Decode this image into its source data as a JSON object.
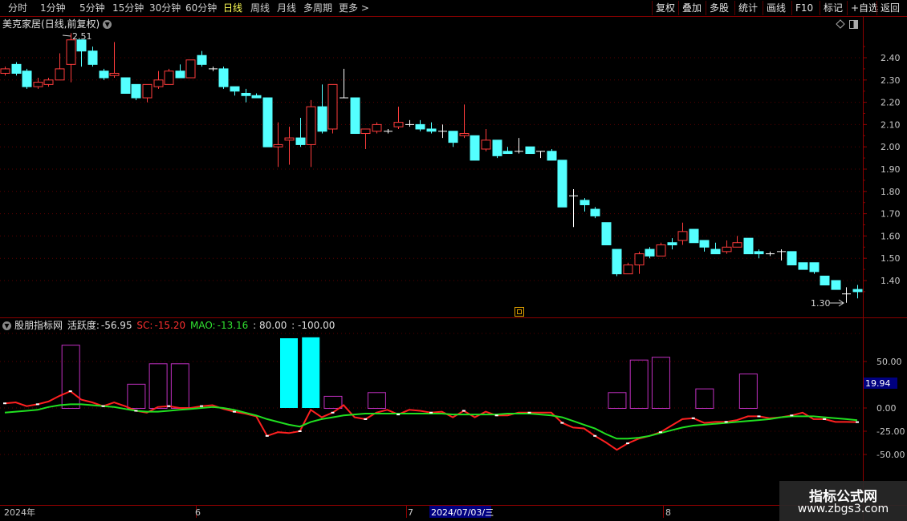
{
  "toolbar": {
    "periods": [
      "分时",
      "1分钟",
      "5分钟",
      "15分钟",
      "30分钟",
      "60分钟",
      "日线",
      "周线",
      "月线",
      "多周期",
      "更多"
    ],
    "active_period": "日线",
    "more_arrow": ">",
    "right_buttons": [
      "复权",
      "叠加",
      "多股",
      "统计",
      "画线",
      "F10",
      "标记",
      "+自选",
      "返回"
    ]
  },
  "main_chart": {
    "stock_name": "美克家居",
    "mode": "(日线,前复权)",
    "high_label": "2.51",
    "low_label": "1.30",
    "price_ticks": [
      "2.40",
      "2.30",
      "2.20",
      "2.10",
      "2.00",
      "1.90",
      "1.80",
      "1.70",
      "1.60",
      "1.50",
      "1.40"
    ]
  },
  "indicator": {
    "name": "股朋指标网",
    "active_label": "活跃度:",
    "active_value": "-56.95",
    "sc_label": "SC:",
    "sc_value": "-15.20",
    "mao_label": "MAO:",
    "mao_value": "-13.16",
    "level1": ": 80.00",
    "level2": ": -100.00",
    "ticks": [
      "50.00",
      "0.00",
      "-25.00",
      "-50.00"
    ],
    "current_badge": "19.94"
  },
  "time_axis": {
    "labels": [
      "2024年",
      "6",
      "7",
      "8"
    ],
    "highlight_date": "2024/07/03/三"
  },
  "watermark": {
    "title": "指标公式网",
    "url": "www.zbgs3.com"
  },
  "colors": {
    "up": "#ff3c3c",
    "down": "#54ffff",
    "sc_line": "#ff2020",
    "mao_line": "#20e020",
    "bars_outline": "#c030c0",
    "bars_fill": "#00ffff",
    "axis": "#8b0000"
  },
  "chart_data": [
    {
      "type": "candlestick",
      "title": "美克家居(日线,前复权)",
      "ylim": [
        1.28,
        2.53
      ],
      "series": [
        {
          "name": "K",
          "ohlc": [
            [
              2.33,
              2.36,
              2.32,
              2.35
            ],
            [
              2.37,
              2.38,
              2.32,
              2.33
            ],
            [
              2.34,
              2.35,
              2.26,
              2.27
            ],
            [
              2.27,
              2.31,
              2.26,
              2.29
            ],
            [
              2.28,
              2.31,
              2.27,
              2.3
            ],
            [
              2.3,
              2.42,
              2.3,
              2.35
            ],
            [
              2.37,
              2.51,
              2.29,
              2.48
            ],
            [
              2.48,
              2.48,
              2.36,
              2.43
            ],
            [
              2.43,
              2.45,
              2.36,
              2.37
            ],
            [
              2.34,
              2.35,
              2.3,
              2.31
            ],
            [
              2.32,
              2.47,
              2.31,
              2.33
            ],
            [
              2.31,
              2.31,
              2.26,
              2.24
            ],
            [
              2.28,
              2.28,
              2.21,
              2.22
            ],
            [
              2.22,
              2.28,
              2.2,
              2.28
            ],
            [
              2.27,
              2.34,
              2.26,
              2.3
            ],
            [
              2.28,
              2.35,
              2.28,
              2.34
            ],
            [
              2.34,
              2.37,
              2.31,
              2.31
            ],
            [
              2.31,
              2.39,
              2.31,
              2.39
            ],
            [
              2.41,
              2.43,
              2.36,
              2.37
            ],
            [
              2.35,
              2.36,
              2.34,
              2.35
            ],
            [
              2.35,
              2.36,
              2.26,
              2.27
            ],
            [
              2.27,
              2.27,
              2.23,
              2.25
            ],
            [
              2.24,
              2.26,
              2.2,
              2.23
            ],
            [
              2.23,
              2.24,
              2.22,
              2.22
            ],
            [
              2.22,
              2.22,
              2.0,
              2.0
            ],
            [
              2.0,
              2.11,
              1.91,
              2.01
            ],
            [
              2.03,
              2.09,
              1.92,
              2.04
            ],
            [
              2.04,
              2.13,
              2.0,
              2.01
            ],
            [
              2.01,
              2.21,
              1.91,
              2.18
            ],
            [
              2.18,
              2.28,
              2.06,
              2.07
            ],
            [
              2.08,
              2.28,
              2.06,
              2.28
            ],
            [
              2.22,
              2.35,
              2.22,
              2.22
            ],
            [
              2.22,
              2.22,
              2.06,
              2.06
            ],
            [
              2.06,
              2.08,
              1.99,
              2.08
            ],
            [
              2.07,
              2.11,
              2.06,
              2.1
            ],
            [
              2.07,
              2.08,
              2.06,
              2.07
            ],
            [
              2.09,
              2.18,
              2.08,
              2.11
            ],
            [
              2.1,
              2.12,
              2.09,
              2.1
            ],
            [
              2.1,
              2.12,
              2.07,
              2.08
            ],
            [
              2.08,
              2.11,
              2.06,
              2.07
            ],
            [
              2.07,
              2.1,
              2.04,
              2.07
            ],
            [
              2.07,
              2.07,
              2.0,
              2.02
            ],
            [
              2.05,
              2.19,
              2.04,
              2.06
            ],
            [
              2.05,
              2.05,
              1.94,
              1.94
            ],
            [
              1.99,
              2.08,
              1.98,
              2.03
            ],
            [
              2.03,
              2.03,
              1.95,
              1.96
            ],
            [
              1.98,
              2.0,
              1.97,
              1.97
            ],
            [
              1.98,
              2.04,
              1.97,
              1.98
            ],
            [
              2.0,
              2.0,
              1.99,
              1.97
            ],
            [
              1.98,
              1.98,
              1.95,
              1.98
            ],
            [
              1.98,
              1.99,
              1.96,
              1.94
            ],
            [
              1.94,
              1.94,
              1.73,
              1.73
            ],
            [
              1.78,
              1.81,
              1.64,
              1.78
            ],
            [
              1.76,
              1.77,
              1.71,
              1.74
            ],
            [
              1.72,
              1.73,
              1.68,
              1.69
            ],
            [
              1.66,
              1.66,
              1.56,
              1.56
            ],
            [
              1.54,
              1.54,
              1.42,
              1.43
            ],
            [
              1.43,
              1.48,
              1.43,
              1.47
            ],
            [
              1.47,
              1.53,
              1.43,
              1.52
            ],
            [
              1.54,
              1.55,
              1.5,
              1.51
            ],
            [
              1.51,
              1.57,
              1.51,
              1.56
            ],
            [
              1.57,
              1.59,
              1.54,
              1.56
            ],
            [
              1.58,
              1.66,
              1.56,
              1.62
            ],
            [
              1.63,
              1.63,
              1.57,
              1.57
            ],
            [
              1.58,
              1.58,
              1.53,
              1.55
            ],
            [
              1.54,
              1.57,
              1.52,
              1.52
            ],
            [
              1.53,
              1.58,
              1.52,
              1.55
            ],
            [
              1.55,
              1.6,
              1.55,
              1.57
            ],
            [
              1.59,
              1.59,
              1.52,
              1.52
            ],
            [
              1.53,
              1.54,
              1.5,
              1.52
            ],
            [
              1.52,
              1.53,
              1.51,
              1.52
            ],
            [
              1.53,
              1.54,
              1.49,
              1.53
            ],
            [
              1.53,
              1.53,
              1.47,
              1.47
            ],
            [
              1.48,
              1.48,
              1.46,
              1.45
            ],
            [
              1.48,
              1.48,
              1.43,
              1.44
            ],
            [
              1.42,
              1.42,
              1.38,
              1.38
            ],
            [
              1.4,
              1.4,
              1.36,
              1.36
            ],
            [
              1.34,
              1.37,
              1.3,
              1.34
            ],
            [
              1.36,
              1.38,
              1.32,
              1.35
            ]
          ]
        }
      ]
    },
    {
      "type": "line",
      "title": "股朋指标网",
      "ylim": [
        -73,
        100
      ],
      "series": [
        {
          "name": "SC",
          "values": [
            5,
            6,
            2,
            4,
            7,
            13,
            18,
            9,
            6,
            2,
            6,
            2,
            -3,
            -5,
            1,
            2,
            0,
            0,
            2,
            3,
            -1,
            -4,
            -6,
            -9,
            -30,
            -26,
            -27,
            -25,
            -2,
            -10,
            -5,
            3,
            -10,
            -12,
            -5,
            -2,
            -7,
            -2,
            -3,
            -5,
            -4,
            -10,
            -3,
            -10,
            -4,
            -8,
            -8,
            -5,
            -5,
            -5,
            -5,
            -16,
            -21,
            -22,
            -30,
            -37,
            -45,
            -38,
            -33,
            -30,
            -26,
            -19,
            -12,
            -11,
            -16,
            -15,
            -15,
            -13,
            -9,
            -9,
            -11,
            -10,
            -8,
            -5,
            -12,
            -12,
            -15,
            -15,
            -15.2
          ]
        },
        {
          "name": "MAO",
          "values": [
            -5,
            -4,
            -3,
            -2,
            1,
            3,
            4,
            4,
            3,
            2,
            1,
            -1,
            -3,
            -4,
            -4,
            -3,
            -2,
            -1,
            0,
            1,
            0,
            -2,
            -5,
            -8,
            -12,
            -15,
            -18,
            -20,
            -15,
            -12,
            -10,
            -8,
            -7,
            -6,
            -6,
            -6,
            -6,
            -6,
            -6,
            -6,
            -6,
            -7,
            -7,
            -7,
            -7,
            -7,
            -6,
            -6,
            -6,
            -7,
            -8,
            -10,
            -14,
            -18,
            -22,
            -28,
            -33,
            -33,
            -32,
            -30,
            -27,
            -24,
            -21,
            -19,
            -18,
            -17,
            -16,
            -15,
            -14,
            -13,
            -12,
            -10,
            -9,
            -9,
            -9,
            -10,
            -11,
            -12,
            -13.16
          ]
        }
      ],
      "bars": [
        {
          "index": 6,
          "value": 68,
          "type": "outline"
        },
        {
          "index": 12,
          "value": 26,
          "type": "outline"
        },
        {
          "index": 14,
          "value": 48,
          "type": "outline"
        },
        {
          "index": 16,
          "value": 48,
          "type": "outline"
        },
        {
          "index": 26,
          "value": 75,
          "type": "filled"
        },
        {
          "index": 28,
          "value": 76,
          "type": "filled"
        },
        {
          "index": 30,
          "value": 13,
          "type": "outline"
        },
        {
          "index": 34,
          "value": 17,
          "type": "outline"
        },
        {
          "index": 56,
          "value": 17,
          "type": "outline"
        },
        {
          "index": 58,
          "value": 52,
          "type": "outline"
        },
        {
          "index": 60,
          "value": 55,
          "type": "outline"
        },
        {
          "index": 64,
          "value": 21,
          "type": "outline"
        },
        {
          "index": 68,
          "value": 37,
          "type": "outline"
        }
      ],
      "levels": [
        80,
        -100
      ]
    }
  ]
}
